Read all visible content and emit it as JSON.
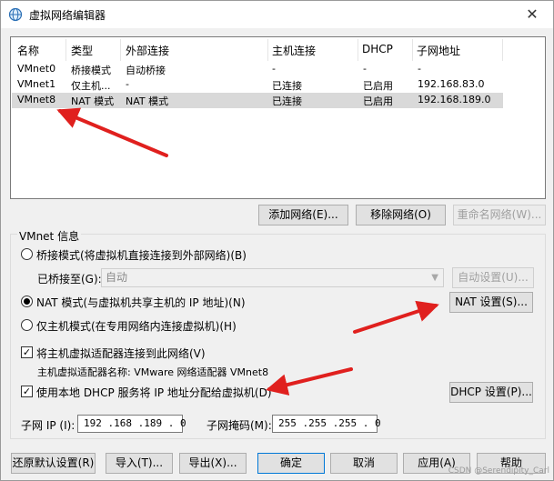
{
  "window": {
    "title": "虚拟网络编辑器",
    "close_glyph": "✕"
  },
  "table": {
    "headers": [
      "名称",
      "类型",
      "外部连接",
      "主机连接",
      "DHCP",
      "子网地址"
    ],
    "rows": [
      [
        "VMnet0",
        "桥接模式",
        "自动桥接",
        "-",
        "-",
        "-"
      ],
      [
        "VMnet1",
        "仅主机...",
        "-",
        "已连接",
        "已启用",
        "192.168.83.0"
      ],
      [
        "VMnet8",
        "NAT 模式",
        "NAT 模式",
        "已连接",
        "已启用",
        "192.168.189.0"
      ]
    ],
    "selected_row": 2
  },
  "table_buttons": {
    "add": "添加网络(E)...",
    "remove": "移除网络(O)",
    "rename": "重命名网络(W)..."
  },
  "vmnet_info": {
    "title": "VMnet 信息",
    "bridged_label": "桥接模式(将虚拟机直接连接到外部网络)(B)",
    "bridged_to_label": "已桥接至(G):",
    "bridged_to_value": "自动",
    "auto_settings": "自动设置(U)...",
    "nat_label": "NAT 模式(与虚拟机共享主机的 IP 地址)(N)",
    "nat_settings": "NAT 设置(S)...",
    "hostonly_label": "仅主机模式(在专用网络内连接虚拟机)(H)",
    "selected_mode": "nat",
    "connect_adapter_label": "将主机虚拟适配器连接到此网络(V)",
    "connect_adapter_checked": true,
    "adapter_name_label": "主机虚拟适配器名称: VMware 网络适配器 VMnet8",
    "dhcp_label": "使用本地 DHCP 服务将 IP 地址分配给虚拟机(D)",
    "dhcp_checked": true,
    "dhcp_settings": "DHCP 设置(P)...",
    "subnet_ip_label": "子网 IP (I):",
    "subnet_ip_value": "192 .168 .189 .  0",
    "subnet_mask_label": "子网掩码(M):",
    "subnet_mask_value": "255 .255 .255 .  0"
  },
  "footer_buttons": {
    "restore": "还原默认设置(R)",
    "import": "导入(T)...",
    "export": "导出(X)...",
    "ok": "确定",
    "cancel": "取消",
    "apply": "应用(A)",
    "help": "帮助"
  },
  "watermark": "CSDN @Serendipity_Carl",
  "colors": {
    "annotation_arrow": "#e0201e",
    "selected_row": "#d9d9d9",
    "window_bg": "#f0f0f0"
  },
  "icons": {
    "title": "globe-network-icon",
    "dropdown": "chevron-down-icon"
  }
}
